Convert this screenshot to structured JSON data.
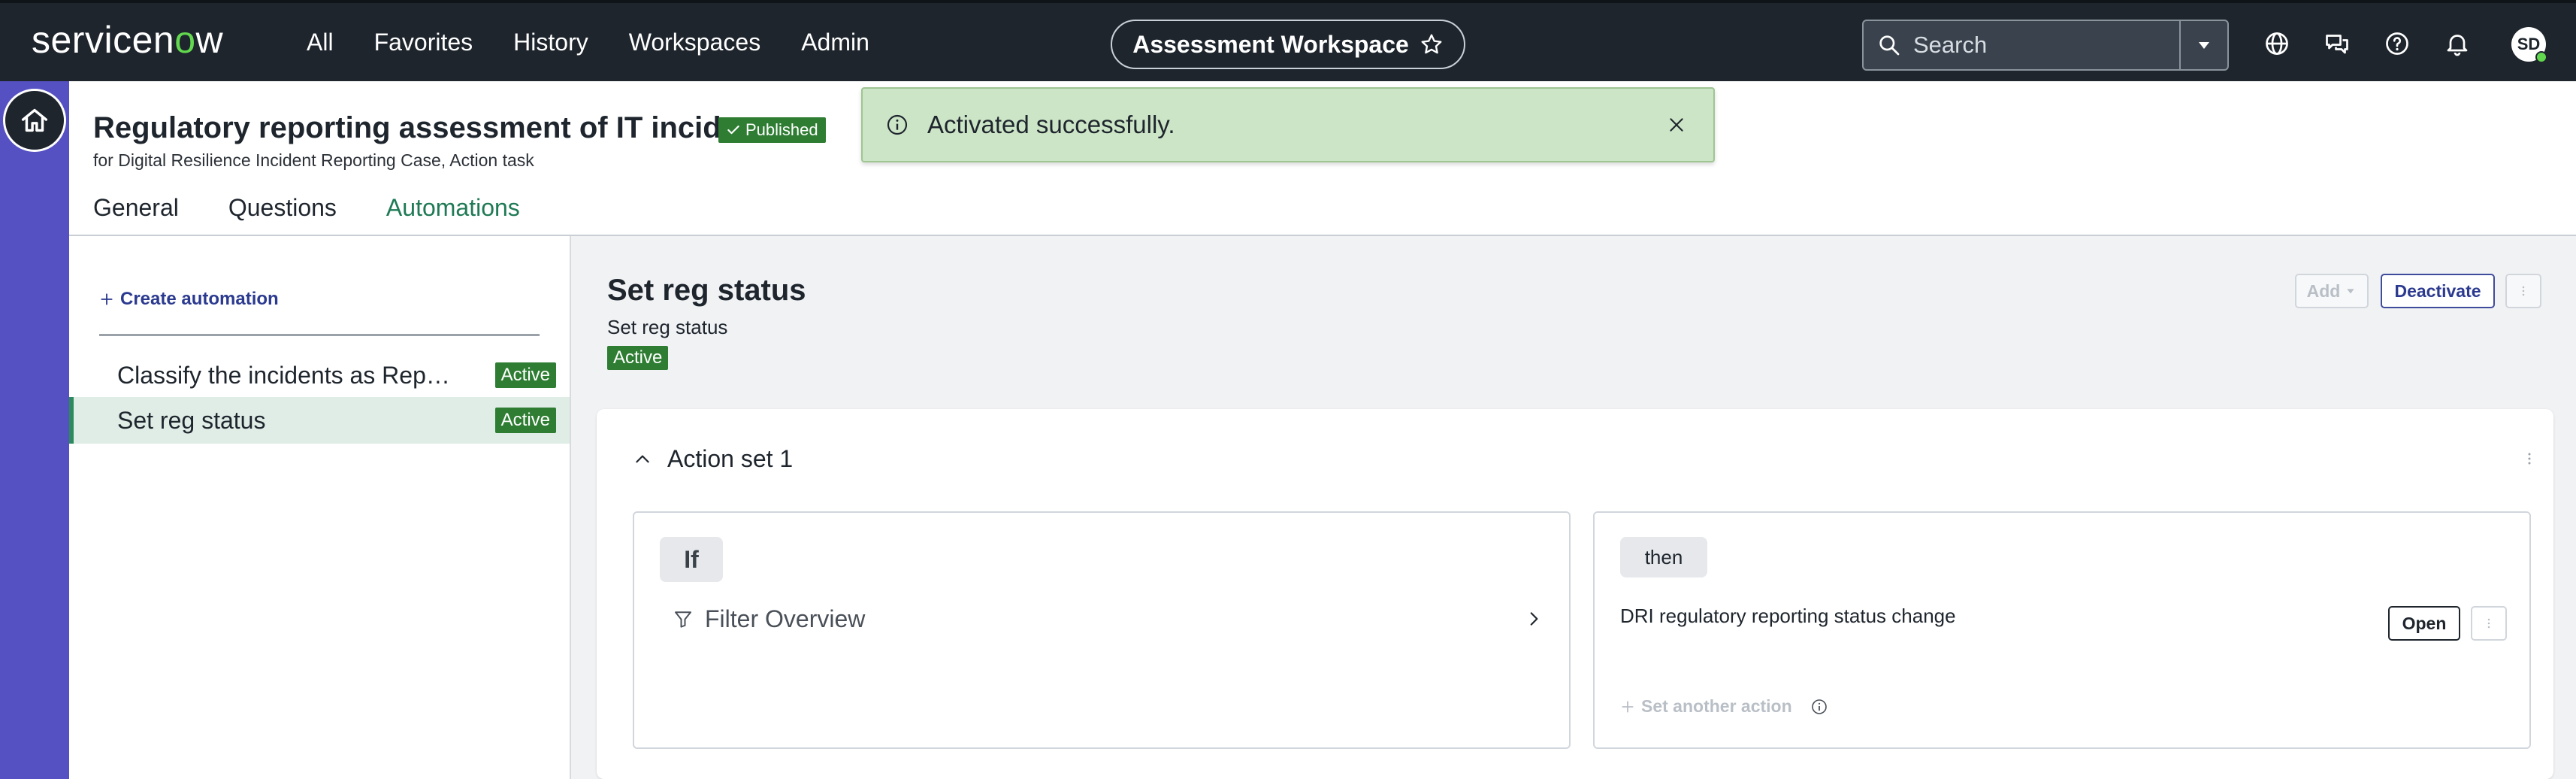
{
  "app": {
    "logo_text_a": "servicen",
    "logo_text_o": "o",
    "logo_text_b": "w"
  },
  "nav": {
    "items": [
      "All",
      "Favorites",
      "History",
      "Workspaces",
      "Admin"
    ],
    "workspace_label": "Assessment Workspace",
    "search_placeholder": "Search",
    "avatar_initials": "SD"
  },
  "header": {
    "title": "Regulatory reporting assessment of IT incidents",
    "status_badge": "Published",
    "subtitle": "for Digital Resilience Incident Reporting Case, Action task",
    "tabs": [
      "General",
      "Questions",
      "Automations"
    ],
    "active_tab": "Automations"
  },
  "toast": {
    "message": "Activated successfully."
  },
  "sidebar": {
    "create_label": "Create automation",
    "items": [
      {
        "label": "Classify the incidents as Reportable",
        "badge": "Active"
      },
      {
        "label": "Set reg status",
        "badge": "Active"
      }
    ]
  },
  "main": {
    "title": "Set reg status",
    "description": "Set reg status",
    "status": "Active",
    "add_label": "Add",
    "deactivate_label": "Deactivate",
    "action_set": {
      "label": "Action set 1",
      "if_label": "If",
      "filter_label": "Filter Overview",
      "then_label": "then",
      "action_label": "DRI regulatory reporting status change",
      "open_label": "Open",
      "set_another_label": "Set another action"
    }
  },
  "colors": {
    "nav_bg": "#1e252d",
    "rail_bg": "#5551c2",
    "accent_green": "#1f7a55",
    "badge_green": "#2e7d32",
    "toast_bg": "#cde5c7",
    "link_blue": "#2b3a8f"
  }
}
